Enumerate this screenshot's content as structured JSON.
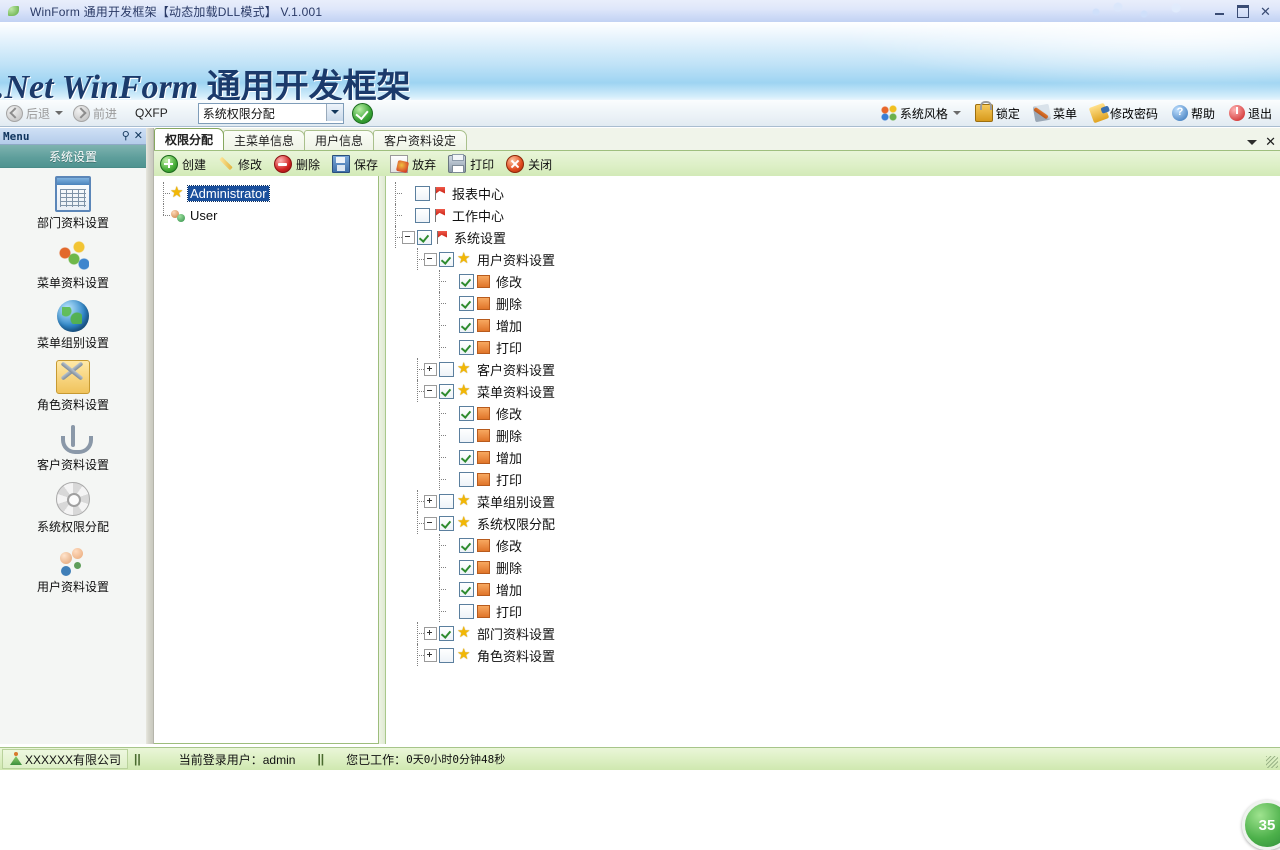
{
  "window": {
    "title": "WinForm 通用开发框架【动态加载DLL模式】 V.1.001",
    "minimize": "—",
    "maximize": "❐",
    "close": "✕"
  },
  "banner": {
    "latin": ".Net WinForm ",
    "cjk": "通用开发框架"
  },
  "toolbar": {
    "back": "后退",
    "forward": "前进",
    "module_code": "QXFP",
    "module_combo_value": "系统权限分配",
    "go_button": "确定",
    "right_items": [
      {
        "label": "系统风格",
        "icon": "palette-icon",
        "has_caret": true
      },
      {
        "label": "锁定",
        "icon": "lock-icon",
        "has_caret": false
      },
      {
        "label": "菜单",
        "icon": "tools-icon",
        "has_caret": false
      },
      {
        "label": "修改密码",
        "icon": "key-icon",
        "has_caret": false
      },
      {
        "label": "帮助",
        "icon": "help-icon",
        "has_caret": false
      },
      {
        "label": "退出",
        "icon": "exit-icon",
        "has_caret": false
      }
    ],
    "help_glyph": "?"
  },
  "sidebar": {
    "header": "Menu",
    "pin": "⚲",
    "close": "✕",
    "section": "系统设置",
    "items": [
      {
        "label": "部门资料设置",
        "icon": "table-icon"
      },
      {
        "label": "菜单资料设置",
        "icon": "nodes-icon"
      },
      {
        "label": "菜单组别设置",
        "icon": "globe-icon"
      },
      {
        "label": "角色资料设置",
        "icon": "tools-badge-icon"
      },
      {
        "label": "客户资料设置",
        "icon": "anchor-icon"
      },
      {
        "label": "系统权限分配",
        "icon": "gear-icon"
      },
      {
        "label": "用户资料设置",
        "icon": "users-icon"
      }
    ]
  },
  "tabs": {
    "items": [
      {
        "label": "权限分配",
        "active": true
      },
      {
        "label": "主菜单信息",
        "active": false
      },
      {
        "label": "用户信息",
        "active": false
      },
      {
        "label": "客户资料设定",
        "active": false
      }
    ],
    "dropdown": "▾",
    "close": "✕"
  },
  "actionbar": [
    {
      "label": "创建",
      "icon": "add-icon"
    },
    {
      "label": "修改",
      "icon": "pencil-icon"
    },
    {
      "label": "删除",
      "icon": "delete-icon"
    },
    {
      "label": "保存",
      "icon": "save-icon"
    },
    {
      "label": "放弃",
      "icon": "discard-icon"
    },
    {
      "label": "打印",
      "icon": "print-icon"
    },
    {
      "label": "关闭",
      "icon": "close-icon"
    }
  ],
  "role_tree": [
    {
      "label": "Administrator",
      "icon": "star-icon",
      "selected": true
    },
    {
      "label": "User",
      "icon": "user-icon",
      "selected": false
    }
  ],
  "permission_tree": [
    {
      "label": "报表中心",
      "icon": "flag-icon",
      "level": 0,
      "checked": false,
      "expander": "none"
    },
    {
      "label": "工作中心",
      "icon": "flag-icon",
      "level": 0,
      "checked": false,
      "expander": "none"
    },
    {
      "label": "系统设置",
      "icon": "flag-icon",
      "level": 0,
      "checked": true,
      "expander": "minus"
    },
    {
      "label": "用户资料设置",
      "icon": "star-icon",
      "level": 1,
      "checked": true,
      "expander": "minus"
    },
    {
      "label": "修改",
      "icon": "square-icon",
      "level": 2,
      "checked": true,
      "expander": "none"
    },
    {
      "label": "删除",
      "icon": "square-icon",
      "level": 2,
      "checked": true,
      "expander": "none"
    },
    {
      "label": "增加",
      "icon": "square-icon",
      "level": 2,
      "checked": true,
      "expander": "none"
    },
    {
      "label": "打印",
      "icon": "square-icon",
      "level": 2,
      "checked": true,
      "expander": "none"
    },
    {
      "label": "客户资料设置",
      "icon": "star-icon",
      "level": 1,
      "checked": false,
      "expander": "plus"
    },
    {
      "label": "菜单资料设置",
      "icon": "star-icon",
      "level": 1,
      "checked": true,
      "expander": "minus"
    },
    {
      "label": "修改",
      "icon": "square-icon",
      "level": 2,
      "checked": true,
      "expander": "none"
    },
    {
      "label": "删除",
      "icon": "square-icon",
      "level": 2,
      "checked": false,
      "expander": "none"
    },
    {
      "label": "增加",
      "icon": "square-icon",
      "level": 2,
      "checked": true,
      "expander": "none"
    },
    {
      "label": "打印",
      "icon": "square-icon",
      "level": 2,
      "checked": false,
      "expander": "none"
    },
    {
      "label": "菜单组别设置",
      "icon": "star-icon",
      "level": 1,
      "checked": false,
      "expander": "plus"
    },
    {
      "label": "系统权限分配",
      "icon": "star-icon",
      "level": 1,
      "checked": true,
      "expander": "minus"
    },
    {
      "label": "修改",
      "icon": "square-icon",
      "level": 2,
      "checked": true,
      "expander": "none"
    },
    {
      "label": "删除",
      "icon": "square-icon",
      "level": 2,
      "checked": true,
      "expander": "none"
    },
    {
      "label": "增加",
      "icon": "square-icon",
      "level": 2,
      "checked": true,
      "expander": "none"
    },
    {
      "label": "打印",
      "icon": "square-icon",
      "level": 2,
      "checked": false,
      "expander": "none"
    },
    {
      "label": "部门资料设置",
      "icon": "star-icon",
      "level": 1,
      "checked": true,
      "expander": "plus"
    },
    {
      "label": "角色资料设置",
      "icon": "star-icon",
      "level": 1,
      "checked": false,
      "expander": "plus"
    }
  ],
  "badge": {
    "value": "35"
  },
  "status": {
    "company": "XXXXXX有限公司",
    "sep1": "||",
    "user_label": "当前登录用户：admin",
    "sep2": "||",
    "worktime_label": "您已工作：",
    "worktime_value": "0天0小时0分钟48秒"
  },
  "colors": {
    "accent_green": "#4cb04a",
    "tab_border": "#a9c08c",
    "selection_blue": "#1a4f9c",
    "banner_text": "#1b3a6b"
  }
}
